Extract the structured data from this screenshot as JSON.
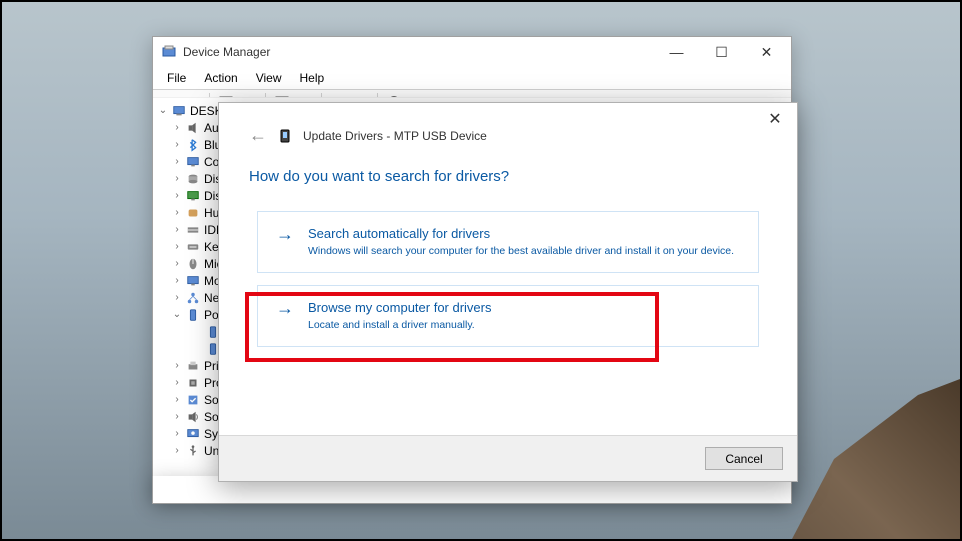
{
  "dm": {
    "title": "Device Manager",
    "menu": {
      "file": "File",
      "action": "Action",
      "view": "View",
      "help": "Help"
    },
    "tree": {
      "root": "DESKTO",
      "items": [
        {
          "label": "Aud",
          "icon": "speaker"
        },
        {
          "label": "Blu",
          "icon": "bluetooth"
        },
        {
          "label": "Cor",
          "icon": "monitor"
        },
        {
          "label": "Disl",
          "icon": "disk"
        },
        {
          "label": "Disp",
          "icon": "display"
        },
        {
          "label": "Hur",
          "icon": "hid"
        },
        {
          "label": "IDE",
          "icon": "ide"
        },
        {
          "label": "Key",
          "icon": "keyboard"
        },
        {
          "label": "Mic",
          "icon": "mouse"
        },
        {
          "label": "Mo",
          "icon": "monitor"
        },
        {
          "label": "Net",
          "icon": "network"
        },
        {
          "label": "Por",
          "icon": "portable",
          "expanded": true
        },
        {
          "label": "Prir",
          "icon": "print"
        },
        {
          "label": "Pro",
          "icon": "processor"
        },
        {
          "label": "Sof",
          "icon": "software"
        },
        {
          "label": "Sou",
          "icon": "sound"
        },
        {
          "label": "Sys",
          "icon": "system"
        },
        {
          "label": "Uni",
          "icon": "usb"
        }
      ]
    }
  },
  "dlg": {
    "title": "Update Drivers - MTP USB Device",
    "heading": "How do you want to search for drivers?",
    "opt1": {
      "title": "Search automatically for drivers",
      "desc": "Windows will search your computer for the best available driver and install it on your device."
    },
    "opt2": {
      "title": "Browse my computer for drivers",
      "desc": "Locate and install a driver manually."
    },
    "cancel": "Cancel"
  }
}
